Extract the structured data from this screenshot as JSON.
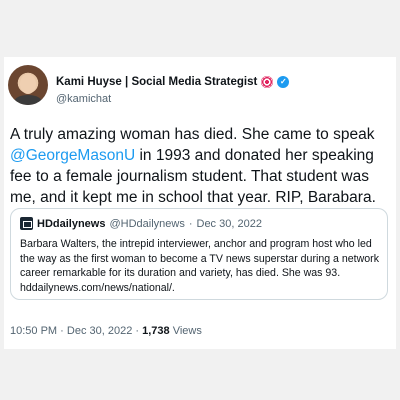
{
  "author": {
    "name": "Kami Huyse | Social Media Strategist",
    "handle": "@kamichat",
    "badge_icon": "target-icon",
    "verified_icon": "verified-icon",
    "verified_color": "#1d9bf0"
  },
  "tweet": {
    "text_before": "A truly amazing woman has died. She came to speak ",
    "mention": "@GeorgeMasonU",
    "text_after": " in 1993 and donated her speaking fee to a female journalism student. That student was me, and it kept me in school that year. RIP,  Barabara."
  },
  "quoted_tweet": {
    "name": "HDdailynews",
    "handle": "@HDdailynews",
    "separator": "·",
    "date": "Dec 30, 2022",
    "text": "Barbara Walters, the intrepid interviewer, anchor and program host who led the way as the first woman to become a TV news superstar during a network career remarkable for its duration and variety, has died. She was 93. hddailynews.com/news/national/."
  },
  "footer": {
    "time": "10:50 PM",
    "separator": "·",
    "date": "Dec 30, 2022",
    "views_count": "1,738",
    "views_label": "Views"
  }
}
